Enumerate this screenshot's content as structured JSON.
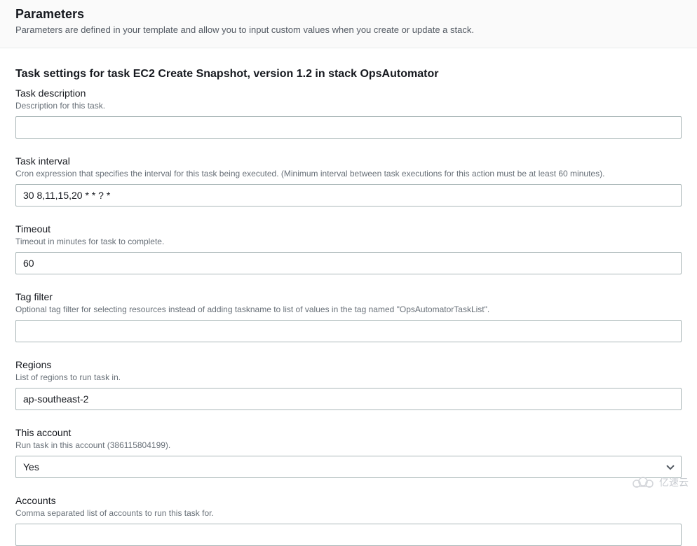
{
  "header": {
    "title": "Parameters",
    "description": "Parameters are defined in your template and allow you to input custom values when you create or update a stack."
  },
  "section_title": "Task settings for task EC2 Create Snapshot, version 1.2 in stack OpsAutomator",
  "fields": {
    "task_description": {
      "label": "Task description",
      "hint": "Description for this task.",
      "value": ""
    },
    "task_interval": {
      "label": "Task interval",
      "hint": "Cron expression that specifies the interval for this task being executed. (Minimum interval between task executions for this action must be at least 60 minutes).",
      "value": "30 8,11,15,20 * * ? *"
    },
    "timeout": {
      "label": "Timeout",
      "hint": "Timeout in minutes for task to complete.",
      "value": "60"
    },
    "tag_filter": {
      "label": "Tag filter",
      "hint": "Optional tag filter for selecting resources instead of adding taskname to list of values in the tag named \"OpsAutomatorTaskList\".",
      "value": ""
    },
    "regions": {
      "label": "Regions",
      "hint": "List of regions to run task in.",
      "value": "ap-southeast-2"
    },
    "this_account": {
      "label": "This account",
      "hint": "Run task in this account (386115804199).",
      "value": "Yes"
    },
    "accounts": {
      "label": "Accounts",
      "hint": "Comma separated list of accounts to run this task for.",
      "value": ""
    }
  },
  "watermark": "亿速云"
}
